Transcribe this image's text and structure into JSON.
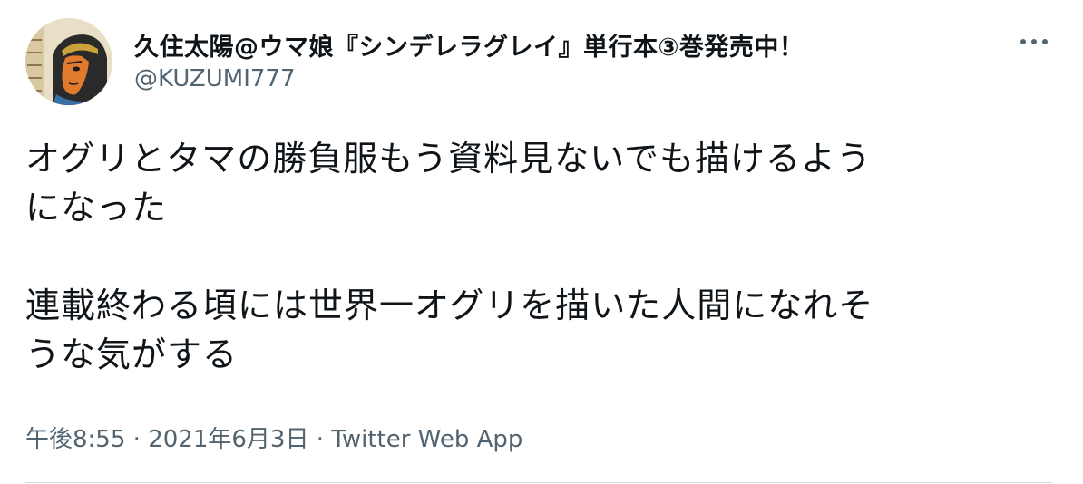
{
  "tweet": {
    "display_name": "久住太陽@ウマ娘『シンデレラグレイ』単行本③巻発売中！",
    "handle": "@KUZUMI777",
    "more_icon": "more-horizontal-icon",
    "text": "オグリとタマの勝負服もう資料見ないでも描けるよう\nになった\n\n連載終わる頃には世界一オグリを描いた人間になれそ\nうな気がする",
    "time": "午後8:55",
    "separator": " · ",
    "date": "2021年6月3日",
    "source": "Twitter Web App"
  },
  "colors": {
    "text": "#0f1419",
    "secondary": "#536471",
    "divider": "#cfd9de"
  }
}
